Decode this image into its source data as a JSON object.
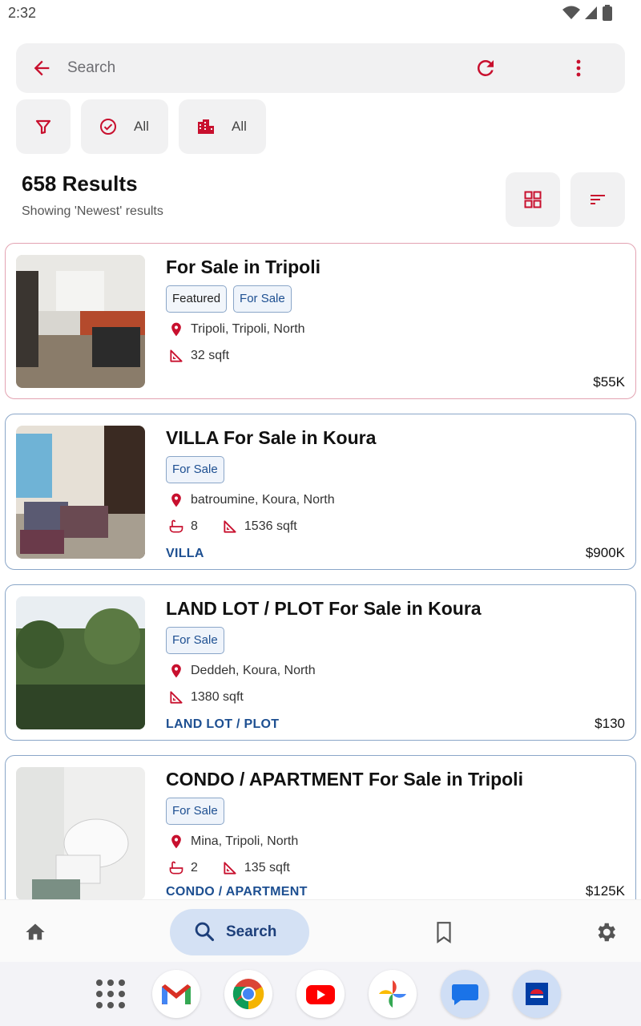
{
  "status_bar": {
    "time": "2:32"
  },
  "search": {
    "placeholder": "Search"
  },
  "filters": {
    "status_label": "All",
    "type_label": "All"
  },
  "results": {
    "count": "658 Results",
    "subtitle": "Showing 'Newest' results"
  },
  "listings": [
    {
      "title": " For Sale in Tripoli",
      "tags": [
        "Featured",
        "For Sale"
      ],
      "location": "Tripoli, Tripoli, North",
      "bedrooms": "",
      "area": "32 sqft",
      "type": "",
      "price": "$55K"
    },
    {
      "title": "VILLA For Sale in Koura",
      "tags": [
        "For Sale"
      ],
      "location": "batroumine, Koura, North",
      "bedrooms": "8",
      "area": "1536 sqft",
      "type": "VILLA",
      "price": "$900K"
    },
    {
      "title": "LAND LOT / PLOT For Sale in Koura",
      "tags": [
        "For Sale"
      ],
      "location": "Deddeh, Koura, North",
      "bedrooms": "",
      "area": "1380 sqft",
      "type": "LAND LOT / PLOT",
      "price": "$130"
    },
    {
      "title": "CONDO / APARTMENT For Sale in Tripoli",
      "tags": [
        "For Sale"
      ],
      "location": "Mina, Tripoli, North",
      "bedrooms": "2",
      "area": "135 sqft",
      "type": "CONDO / APARTMENT",
      "price": "$125K"
    }
  ],
  "bottom_nav": {
    "search_label": "Search"
  },
  "colors": {
    "accent": "#c8102e",
    "brand_blue": "#1d4f91",
    "nav_active": "#d4e1f4"
  },
  "icons": [
    "back-arrow-icon",
    "refresh-icon",
    "more-vert-icon",
    "filter-icon",
    "check-circle-icon",
    "buildings-icon",
    "grid-view-icon",
    "sort-icon",
    "location-pin-icon",
    "area-ruler-icon",
    "bathtub-icon",
    "home-icon",
    "search-icon",
    "bookmark-icon",
    "gear-icon"
  ]
}
